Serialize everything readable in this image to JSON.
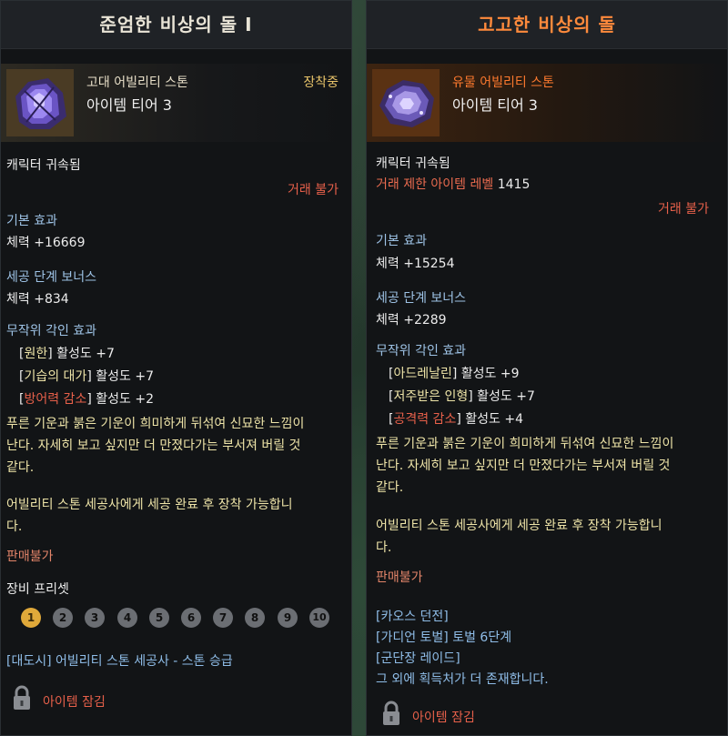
{
  "left": {
    "title": "준엄한 비상의 돌 I",
    "grade": "고대 어빌리티 스톤",
    "tier": "아이템 티어 3",
    "equipped": "장착중",
    "bound": "캐릭터 귀속됨",
    "trade": "거래 불가",
    "base_effect_label": "기본 효과",
    "base_effect_value": "체력 +16669",
    "bonus_label": "세공 단계 보너스",
    "bonus_value": "체력 +834",
    "engrave_label": "무작위 각인 효과",
    "engravings": [
      {
        "open": "[",
        "name": "원한",
        "close": "]",
        "effect": " 활성도 +7"
      },
      {
        "open": "[",
        "name": "기습의 대가",
        "close": "]",
        "effect": " 활성도 +7"
      },
      {
        "open": "[",
        "name": "방어력 감소",
        "close": "]",
        "effect": " 활성도 +2"
      }
    ],
    "flavor_lines": [
      "푸른 기운과 붉은 기운이 희미하게 뒤섞여 신묘한 느낌이",
      "난다. 자세히 보고 싶지만 더 만졌다가는 부서져 버릴 것",
      "같다."
    ],
    "equip_note_lines": [
      "어빌리티 스톤 세공사에게 세공 완료 후 장착 가능합니",
      "다."
    ],
    "sell": "판매불가",
    "preset_label": "장비 프리셋",
    "presets": [
      "1",
      "2",
      "3",
      "4",
      "5",
      "6",
      "7",
      "8",
      "9",
      "10"
    ],
    "active_preset": "1",
    "source": "[대도시] 어빌리티 스톤 세공사 - 스톤 승급",
    "lock_text": "아이템 잠김"
  },
  "right": {
    "title": "고고한 비상의 돌",
    "grade": "유물 어빌리티 스톤",
    "tier": "아이템 티어 3",
    "bound": "캐릭터 귀속됨",
    "trade_limit_label": "거래 제한 아이템 레벨",
    "trade_limit_value": "1415",
    "trade": "거래 불가",
    "base_effect_label": "기본 효과",
    "base_effect_value": "체력 +15254",
    "bonus_label": "세공 단계 보너스",
    "bonus_value": "체력 +2289",
    "engrave_label": "무작위 각인 효과",
    "engravings": [
      {
        "open": "[",
        "name": "아드레날린",
        "close": "]",
        "effect": " 활성도 +9"
      },
      {
        "open": "[",
        "name": "저주받은 인형",
        "close": "]",
        "effect": " 활성도 +7"
      },
      {
        "open": "[",
        "name": "공격력 감소",
        "close": "]",
        "effect": " 활성도 +4"
      }
    ],
    "flavor_lines": [
      "푸른 기운과 붉은 기운이 희미하게 뒤섞여 신묘한 느낌이",
      "난다. 자세히 보고 싶지만 더 만졌다가는 부서져 버릴 것",
      "같다."
    ],
    "equip_note_lines": [
      "어빌리티 스톤 세공사에게 세공 완료 후 장착 가능합니",
      "다."
    ],
    "sell": "판매불가",
    "sources": [
      "[카오스 던전]",
      "[가디언 토벌] 토벌 6단계",
      "[군단장 레이드]",
      "그 외에 획득처가 더 존재합니다."
    ],
    "lock_text": "아이템 잠김"
  },
  "colors": {
    "relic_title": "#ff8a3c",
    "negative_engraving": "#e7604a",
    "flavor_text": "#eee4a8",
    "section_label": "#9ec3e6"
  }
}
